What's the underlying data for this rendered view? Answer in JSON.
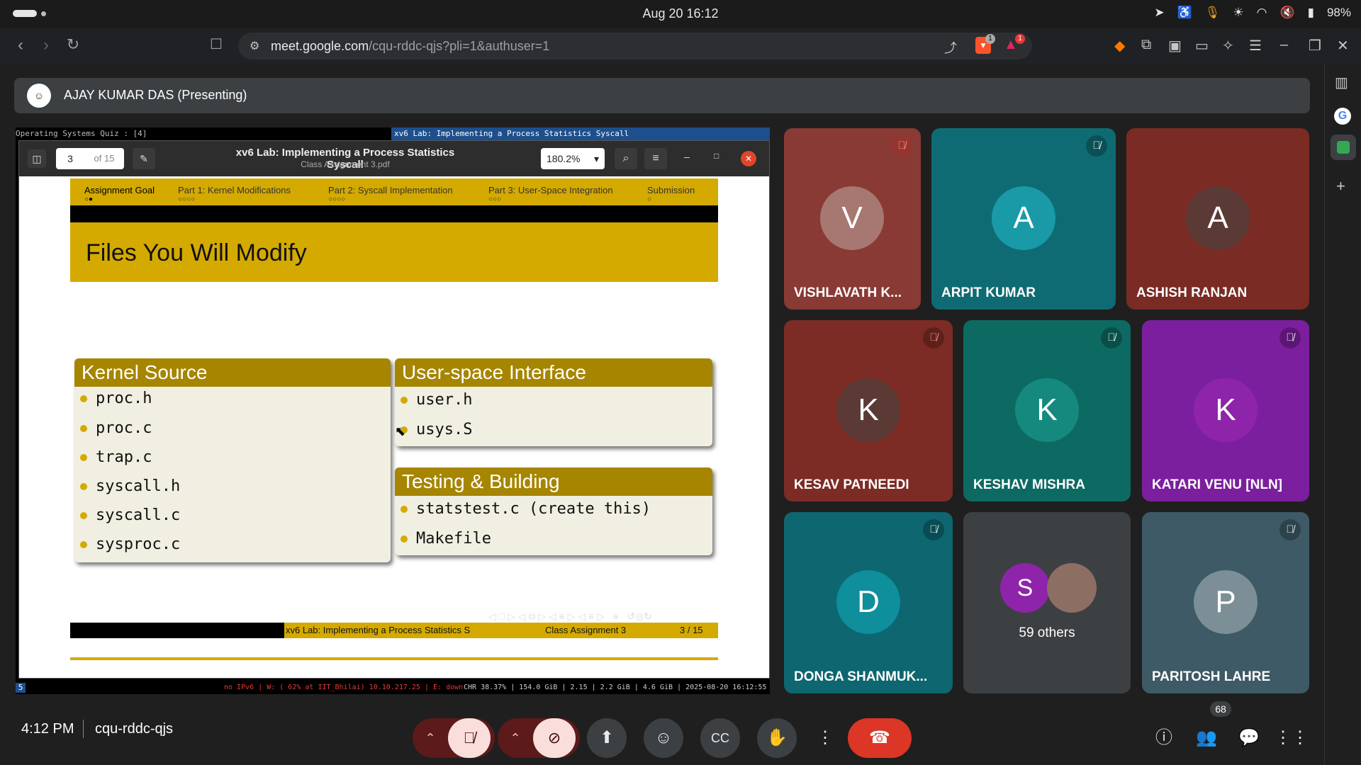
{
  "system": {
    "datetime": "Aug 20  16:12",
    "battery": "98%"
  },
  "browser": {
    "url_host": "meet.google.com",
    "url_path": "/cqu-rddc-qjs?pli=1&authuser=1",
    "shields_badge": "1",
    "rewards_badge": "1"
  },
  "presenter": {
    "label": "AJAY KUMAR DAS (Presenting)"
  },
  "terminal": {
    "left_title": "Operating Systems  Quiz : [4]",
    "window_title": "xv6 Lab: Implementing a Process Statistics Syscall",
    "status_index": "5",
    "status_net": "no IPv6 | W: ( 62% at IIT_Bhilai) 10.10.217.25 | E: down",
    "status_sys": "CHR 38.37% | 154.0 GiB | 2.15 | 2.2 GiB | 4.6 GiB | 2025-08-20 16:12:55"
  },
  "pdf": {
    "page_current": "3",
    "page_total": "of 15",
    "title": "xv6 Lab: Implementing a Process Statistics Syscall",
    "subtitle": "Class Assignment 3.pdf",
    "zoom": "180.2%"
  },
  "slide": {
    "nav": [
      "Assignment Goal",
      "Part 1: Kernel Modifications",
      "Part 2: Syscall Implementation",
      "Part 3: User-Space Integration",
      "Submission"
    ],
    "title": "Files You Will Modify",
    "kernel_block": {
      "heading": "Kernel Source",
      "items": [
        "proc.h",
        "proc.c",
        "trap.c",
        "syscall.h",
        "syscall.c",
        "sysproc.c"
      ]
    },
    "user_block": {
      "heading": "User-space Interface",
      "items": [
        "user.h",
        "usys.S"
      ]
    },
    "test_block": {
      "heading": "Testing & Building",
      "items": [
        "statstest.c (create this)",
        "Makefile"
      ]
    },
    "footer_title": "xv6 Lab: Implementing a Process Statistics S",
    "footer_mid": "Class Assignment 3",
    "footer_page": "3 / 15"
  },
  "participants": [
    {
      "initial": "V",
      "name": "VISHLAVATH K...",
      "bg": "#8a3a34",
      "avatar": "#a77872"
    },
    {
      "initial": "A",
      "name": "ARPIT KUMAR",
      "bg": "#0f6b73",
      "avatar": "#1a9aa6"
    },
    {
      "initial": "A",
      "name": "ASHISH RANJAN",
      "bg": "#7a2b24",
      "avatar": "#5b3a36"
    },
    {
      "initial": "K",
      "name": "KESAV PATNEEDI",
      "bg": "#7c2c25",
      "avatar": "#5b3a36"
    },
    {
      "initial": "K",
      "name": "KESHAV MISHRA",
      "bg": "#0d6a62",
      "avatar": "#15897e"
    },
    {
      "initial": "K",
      "name": "KATARI VENU [NLN]",
      "bg": "#7b1f9e",
      "avatar": "#8e24aa"
    },
    {
      "initial": "D",
      "name": "DONGA SHANMUK...",
      "bg": "#0d6670",
      "avatar": "#0f8e9c"
    },
    {
      "initial": "S",
      "name": "59 others",
      "bg": "#3c4043",
      "avatar": "#8e24aa"
    },
    {
      "initial": "P",
      "name": "PARITOSH LAHRE",
      "bg": "#3d5a66",
      "avatar": "#7c8f96"
    }
  ],
  "bottom": {
    "time": "4:12 PM",
    "meeting_code": "cqu-rddc-qjs",
    "participant_count": "68"
  }
}
